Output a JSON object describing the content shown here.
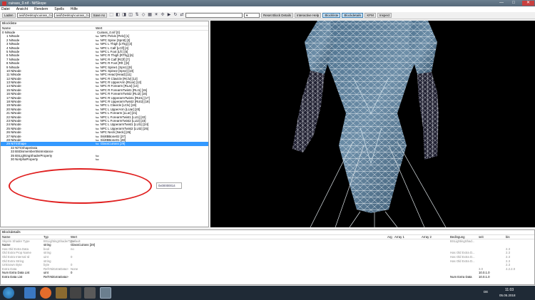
{
  "window": {
    "title": "cuirass_0.nif - NifSkope",
    "close": "✕",
    "maximize": "□",
    "minimize": "—"
  },
  "menu": [
    "Datei",
    "Ansicht",
    "Rendern",
    "Spells",
    "Hilfe"
  ],
  "toolbar": {
    "load": "Laden",
    "path1": "avid\\Desktop\\cuirass_0.nif",
    "path2": "avid\\Desktop\\cuirass_0.nif",
    "save": "Save As",
    "reset": "Reset Block Details",
    "help": "Interactive Help",
    "blocklist": "Blockliste",
    "blockdetails": "Blockdetails",
    "kfm": "KFM",
    "inspect": "Inspect"
  },
  "blocklist": {
    "title": "Blockliste",
    "col_name": "Name",
    "col_value": "Wert",
    "rows": [
      {
        "name": "0 NiNode",
        "value": "Cuirass_0.nif [0]",
        "indent": 0,
        "flag": ""
      },
      {
        "name": "1 NiNode",
        "value": "NPC Pelvis [Pelv] [1]",
        "indent": 1,
        "flag": "fuc"
      },
      {
        "name": "2 NiNode",
        "value": "NPC Spine [Spn0] [2]",
        "indent": 1,
        "flag": "fuc"
      },
      {
        "name": "3 NiNode",
        "value": "NPC L Thigh [LThg] [3]",
        "indent": 1,
        "flag": "fuc"
      },
      {
        "name": "4 NiNode",
        "value": "NPC L Calf [LClf] [4]",
        "indent": 1,
        "flag": "fuc"
      },
      {
        "name": "5 NiNode",
        "value": "NPC L Foot [Lft ] [5]",
        "indent": 1,
        "flag": "fuc"
      },
      {
        "name": "6 NiNode",
        "value": "NPC R Thigh [RThg] [6]",
        "indent": 1,
        "flag": "fuc"
      },
      {
        "name": "7 NiNode",
        "value": "NPC R Calf [RClf] [7]",
        "indent": 1,
        "flag": "fuc"
      },
      {
        "name": "8 NiNode",
        "value": "NPC R Foot [Rft ] [8]",
        "indent": 1,
        "flag": "fuc"
      },
      {
        "name": "9 NiNode",
        "value": "NPC Spine1 [Spn1] [9]",
        "indent": 1,
        "flag": "fuc"
      },
      {
        "name": "10 NiNode",
        "value": "NPC Spine2 [Spn2] [10]",
        "indent": 1,
        "flag": "fuc"
      },
      {
        "name": "11 NiNode",
        "value": "NPC Head [Head] [11]",
        "indent": 1,
        "flag": "fuc"
      },
      {
        "name": "12 NiNode",
        "value": "NPC R Clavicle [RClv] [12]",
        "indent": 1,
        "flag": "fuc"
      },
      {
        "name": "13 NiNode",
        "value": "NPC R UpperArm [RUar] [13]",
        "indent": 1,
        "flag": "fuc"
      },
      {
        "name": "14 NiNode",
        "value": "NPC R Forearm [RLar] [14]",
        "indent": 1,
        "flag": "fuc"
      },
      {
        "name": "15 NiNode",
        "value": "NPC R ForearmTwist1 [RLt1] [15]",
        "indent": 1,
        "flag": "fuc"
      },
      {
        "name": "16 NiNode",
        "value": "NPC R ForearmTwist2 [RLt2] [16]",
        "indent": 1,
        "flag": "fuc"
      },
      {
        "name": "17 NiNode",
        "value": "NPC R UpperarmTwist1 [RUt1] [17]",
        "indent": 1,
        "flag": "fuc"
      },
      {
        "name": "18 NiNode",
        "value": "NPC R UpperarmTwist2 [RUt2] [18]",
        "indent": 1,
        "flag": "fuc"
      },
      {
        "name": "19 NiNode",
        "value": "NPC L Clavicle [LClv] [19]",
        "indent": 1,
        "flag": "fuc"
      },
      {
        "name": "20 NiNode",
        "value": "NPC L UpperArm [LUar] [20]",
        "indent": 1,
        "flag": "fuc"
      },
      {
        "name": "21 NiNode",
        "value": "NPC L Forearm [LLar] [21]",
        "indent": 1,
        "flag": "fuc"
      },
      {
        "name": "22 NiNode",
        "value": "NPC L ForearmTwist1 [LLt1] [22]",
        "indent": 1,
        "flag": "fuc"
      },
      {
        "name": "23 NiNode",
        "value": "NPC L ForearmTwist2 [LLt2] [23]",
        "indent": 1,
        "flag": "fuc"
      },
      {
        "name": "24 NiNode",
        "value": "NPC L UpperarmTwist1 [LUt1] [24]",
        "indent": 1,
        "flag": "fuc"
      },
      {
        "name": "25 NiNode",
        "value": "NPC L UpperarmTwist2 [LUt2] [25]",
        "indent": 1,
        "flag": "fuc"
      },
      {
        "name": "26 NiNode",
        "value": "NPC Neck [Neck] [26]",
        "indent": 1,
        "flag": "fuc"
      },
      {
        "name": "27 NiNode",
        "value": "SkirtBBone02 [27]",
        "indent": 1,
        "flag": "fuc"
      },
      {
        "name": "28 NiNode",
        "value": "SkirtBBone01 [28]",
        "indent": 1,
        "flag": "fuc"
      },
      {
        "name": "29 NiTriShape",
        "value": "GlassCuirass [29]",
        "indent": 1,
        "flag": "fuc",
        "selected": true
      },
      {
        "name": "32 NiTriShapeData",
        "value": "",
        "indent": 2,
        "flag": ""
      },
      {
        "name": "33 BSDismemberSkinInstance",
        "value": "",
        "indent": 2,
        "flag": ""
      },
      {
        "name": "35 BSLightingShaderProperty",
        "value": "",
        "indent": 2,
        "flag": "fuc"
      },
      {
        "name": "30 NiAlphaProperty",
        "value": "",
        "indent": 2,
        "flag": "fuc"
      }
    ]
  },
  "tooltip": "0x00000014",
  "blockdetails": {
    "title": "Blockdetails",
    "cols": [
      "Name",
      "Typ",
      "Wert",
      "Arg",
      "Array 1",
      "Array 2",
      "Bedingung",
      "seit",
      "bis"
    ],
    "rows": [
      {
        "name": "Skyrim Shader Type",
        "type": "BSLightingShaderType",
        "value": "Default",
        "cond": "BSLightingShad...",
        "since": "",
        "until": "",
        "grey": true
      },
      {
        "name": "Name",
        "type": "string",
        "value": "GlassCuirass [29]",
        "cond": "",
        "since": "",
        "until": "",
        "grey": false
      },
      {
        "name": "Has Old Extra Data",
        "type": "bool",
        "value": "no",
        "cond": "",
        "since": "",
        "until": "2.3",
        "grey": true
      },
      {
        "name": "Old Extra Prop Name",
        "type": "string",
        "value": "",
        "cond": "Has Old Extra D...",
        "since": "",
        "until": "2.3",
        "grey": true
      },
      {
        "name": "Old Extra Internal Id",
        "type": "uint",
        "value": "0",
        "cond": "Has Old Extra D...",
        "since": "",
        "until": "2.3",
        "grey": true
      },
      {
        "name": "Old Extra String",
        "type": "string",
        "value": "",
        "cond": "Has Old Extra D...",
        "since": "",
        "until": "2.3",
        "grey": true
      },
      {
        "name": "Unknown Byte",
        "type": "byte",
        "value": "0",
        "cond": "",
        "since": "",
        "until": "2.3",
        "grey": true
      },
      {
        "name": "Extra Data",
        "type": "Ref<NiExtraData>",
        "value": "None",
        "cond": "",
        "since": "3.0",
        "until": "4.2.2.0",
        "grey": true
      },
      {
        "name": "Num Extra Data List",
        "type": "uint",
        "value": "0",
        "cond": "",
        "since": "10.0.1.0",
        "until": "",
        "grey": false
      },
      {
        "name": "Extra Data List",
        "type": "Ref<NiExtraData>",
        "value": "",
        "cond": "Num Extra Data",
        "since": "10.0.1.0",
        "until": "",
        "grey": false
      }
    ]
  },
  "clock": {
    "time": "11:03",
    "date": "05.05.2018",
    "lang": "DE"
  }
}
